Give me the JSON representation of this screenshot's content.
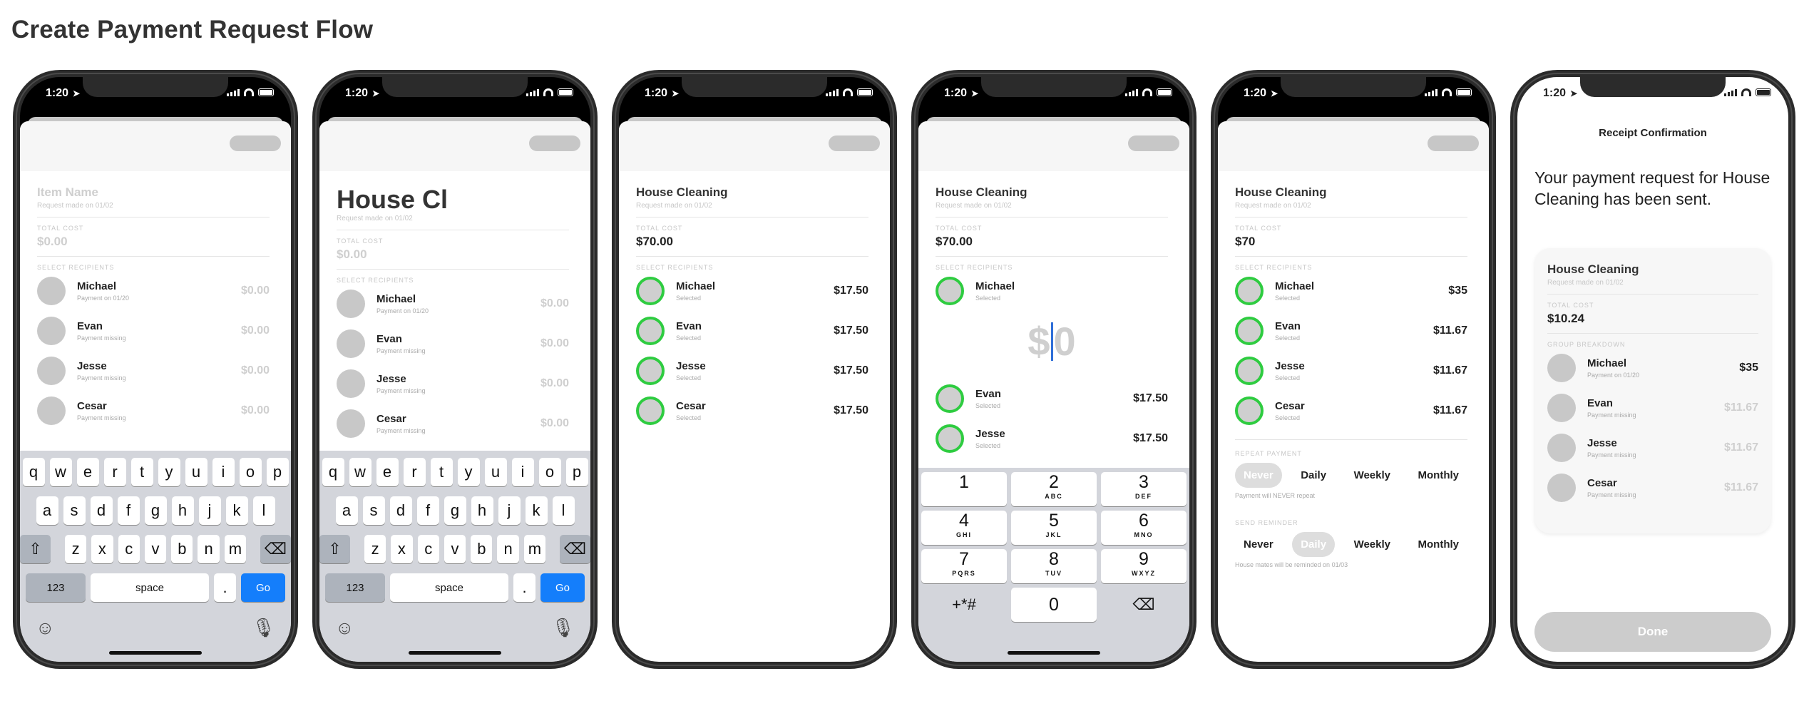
{
  "page_title": "Create Payment Request Flow",
  "status_time": "1:20",
  "screens": [
    {
      "item_title": "Item Name",
      "request_meta": "Request made on 01/02",
      "total_label": "TOTAL COST",
      "total": "$0.00",
      "recipients_label": "SELECT RECIPIENTS",
      "recipients": [
        {
          "name": "Michael",
          "status": "Payment on 01/20",
          "amount": "$0.00"
        },
        {
          "name": "Evan",
          "status": "Payment missing",
          "amount": "$0.00"
        },
        {
          "name": "Jesse",
          "status": "Payment missing",
          "amount": "$0.00"
        },
        {
          "name": "Cesar",
          "status": "Payment missing",
          "amount": "$0.00"
        }
      ]
    },
    {
      "item_title": "House Cl",
      "request_meta": "Request made on 01/02",
      "total_label": "TOTAL COST",
      "total": "$0.00",
      "recipients_label": "SELECT RECIPIENTS",
      "recipients": [
        {
          "name": "Michael",
          "status": "Payment on 01/20",
          "amount": "$0.00"
        },
        {
          "name": "Evan",
          "status": "Payment missing",
          "amount": "$0.00"
        },
        {
          "name": "Jesse",
          "status": "Payment missing",
          "amount": "$0.00"
        },
        {
          "name": "Cesar",
          "status": "Payment missing",
          "amount": "$0.00"
        }
      ]
    },
    {
      "item_title": "House Cleaning",
      "request_meta": "Request made on 01/02",
      "total_label": "TOTAL COST",
      "total": "$70.00",
      "recipients_label": "SELECT RECIPIENTS",
      "recipients": [
        {
          "name": "Michael",
          "status": "Selected",
          "amount": "$17.50"
        },
        {
          "name": "Evan",
          "status": "Selected",
          "amount": "$17.50"
        },
        {
          "name": "Jesse",
          "status": "Selected",
          "amount": "$17.50"
        },
        {
          "name": "Cesar",
          "status": "Selected",
          "amount": "$17.50"
        }
      ]
    },
    {
      "item_title": "House Cleaning",
      "request_meta": "Request made on 01/02",
      "total_label": "TOTAL COST",
      "total": "$70.00",
      "recipients_label": "SELECT RECIPIENTS",
      "first": {
        "name": "Michael",
        "status": "Selected"
      },
      "amount_dollar": "$",
      "amount_value": "0",
      "recipients": [
        {
          "name": "Evan",
          "status": "Selected",
          "amount": "$17.50"
        },
        {
          "name": "Jesse",
          "status": "Selected",
          "amount": "$17.50"
        }
      ]
    },
    {
      "item_title": "House Cleaning",
      "request_meta": "Request made on 01/02",
      "total_label": "TOTAL COST",
      "total": "$70",
      "recipients_label": "SELECT RECIPIENTS",
      "recipients": [
        {
          "name": "Michael",
          "status": "Selected",
          "amount": "$35"
        },
        {
          "name": "Evan",
          "status": "Selected",
          "amount": "$11.67"
        },
        {
          "name": "Jesse",
          "status": "Selected",
          "amount": "$11.67"
        },
        {
          "name": "Cesar",
          "status": "Selected",
          "amount": "$11.67"
        }
      ],
      "repeat_label": "REPEAT PAYMENT",
      "repeat_options": [
        "Never",
        "Daily",
        "Weekly",
        "Monthly"
      ],
      "repeat_note": "Payment will NEVER repeat",
      "reminder_label": "SEND REMINDER",
      "reminder_options": [
        "Never",
        "Daily",
        "Weekly",
        "Monthly"
      ],
      "reminder_note": "House mates will be reminded on 01/03"
    },
    {
      "header": "Receipt Confirmation",
      "message": "Your payment request for House Cleaning has been sent.",
      "item_title": "House Cleaning",
      "request_meta": "Request made on 01/02",
      "total_label": "TOTAL COST",
      "total": "$10.24",
      "breakdown_label": "GROUP BREAKDOWN",
      "recipients": [
        {
          "name": "Michael",
          "status": "Payment on 01/20",
          "amount": "$35"
        },
        {
          "name": "Evan",
          "status": "Payment missing",
          "amount": "$11.67"
        },
        {
          "name": "Jesse",
          "status": "Payment missing",
          "amount": "$11.67"
        },
        {
          "name": "Cesar",
          "status": "Payment missing",
          "amount": "$11.67"
        }
      ],
      "done_label": "Done"
    }
  ],
  "keyboard": {
    "row1": [
      "q",
      "w",
      "e",
      "r",
      "t",
      "y",
      "u",
      "i",
      "o",
      "p"
    ],
    "row2": [
      "a",
      "s",
      "d",
      "f",
      "g",
      "h",
      "j",
      "k",
      "l"
    ],
    "row3": [
      "z",
      "x",
      "c",
      "v",
      "b",
      "n",
      "m"
    ],
    "numbers_key": "123",
    "space_key": "space",
    "period_key": ".",
    "go_key": "Go"
  },
  "numpad": [
    [
      {
        "d": "1",
        "l": ""
      },
      {
        "d": "2",
        "l": "ABC"
      },
      {
        "d": "3",
        "l": "DEF"
      }
    ],
    [
      {
        "d": "4",
        "l": "GHI"
      },
      {
        "d": "5",
        "l": "JKL"
      },
      {
        "d": "6",
        "l": "MNO"
      }
    ],
    [
      {
        "d": "7",
        "l": "PQRS"
      },
      {
        "d": "8",
        "l": "TUV"
      },
      {
        "d": "9",
        "l": "WXYZ"
      }
    ]
  ],
  "numpad_symbols": "+*#",
  "numpad_zero": "0",
  "colors": {
    "selected_ring": "#2ecc40",
    "go_key": "#147efb",
    "caret": "#2e6ed8"
  }
}
